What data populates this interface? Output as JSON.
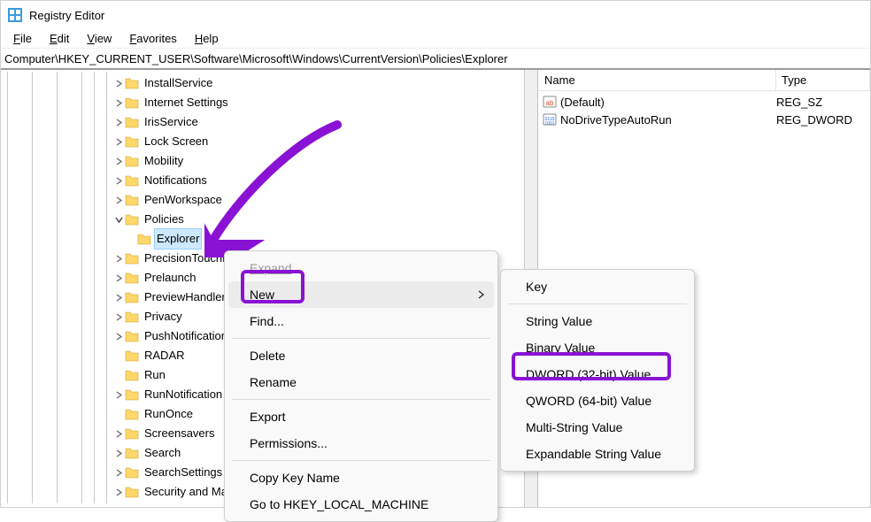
{
  "title": "Registry Editor",
  "menubar": {
    "file": "File",
    "edit": "Edit",
    "view": "View",
    "favorites": "Favorites",
    "help": "Help"
  },
  "address": "Computer\\HKEY_CURRENT_USER\\Software\\Microsoft\\Windows\\CurrentVersion\\Policies\\Explorer",
  "tree": [
    {
      "indent": 9,
      "exp": "r",
      "label": "InstallService"
    },
    {
      "indent": 9,
      "exp": "r",
      "label": "Internet Settings"
    },
    {
      "indent": 9,
      "exp": "r",
      "label": "IrisService"
    },
    {
      "indent": 9,
      "exp": "r",
      "label": "Lock Screen"
    },
    {
      "indent": 9,
      "exp": "r",
      "label": "Mobility"
    },
    {
      "indent": 9,
      "exp": "r",
      "label": "Notifications"
    },
    {
      "indent": 9,
      "exp": "r",
      "label": "PenWorkspace"
    },
    {
      "indent": 9,
      "exp": "d",
      "label": "Policies"
    },
    {
      "indent": 10,
      "exp": "",
      "label": "Explorer",
      "selected": true
    },
    {
      "indent": 9,
      "exp": "r",
      "label": "PrecisionTouchPad"
    },
    {
      "indent": 9,
      "exp": "r",
      "label": "Prelaunch"
    },
    {
      "indent": 9,
      "exp": "r",
      "label": "PreviewHandlers"
    },
    {
      "indent": 9,
      "exp": "r",
      "label": "Privacy"
    },
    {
      "indent": 9,
      "exp": "r",
      "label": "PushNotifications"
    },
    {
      "indent": 9,
      "exp": "",
      "label": "RADAR"
    },
    {
      "indent": 9,
      "exp": "",
      "label": "Run"
    },
    {
      "indent": 9,
      "exp": "r",
      "label": "RunNotification"
    },
    {
      "indent": 9,
      "exp": "",
      "label": "RunOnce"
    },
    {
      "indent": 9,
      "exp": "r",
      "label": "Screensavers"
    },
    {
      "indent": 9,
      "exp": "r",
      "label": "Search"
    },
    {
      "indent": 9,
      "exp": "r",
      "label": "SearchSettings"
    },
    {
      "indent": 9,
      "exp": "r",
      "label": "Security and Maintenance"
    }
  ],
  "indent_lines": [
    true,
    false,
    true,
    false,
    true,
    false,
    true,
    true,
    true,
    false
  ],
  "list": {
    "headers": {
      "name": "Name",
      "type": "Type"
    },
    "rows": [
      {
        "icon": "str",
        "name": "(Default)",
        "type": "REG_SZ"
      },
      {
        "icon": "num",
        "name": "NoDriveTypeAutoRun",
        "type": "REG_DWORD"
      }
    ]
  },
  "ctx1": {
    "expand": "Expand",
    "new": "New",
    "find": "Find...",
    "delete": "Delete",
    "rename": "Rename",
    "export": "Export",
    "permissions": "Permissions...",
    "copy": "Copy Key Name",
    "goto": "Go to HKEY_LOCAL_MACHINE"
  },
  "ctx2": {
    "key": "Key",
    "string": "String Value",
    "binary": "Binary Value",
    "dword": "DWORD (32-bit) Value",
    "qword": "QWORD (64-bit) Value",
    "multi": "Multi-String Value",
    "expand": "Expandable String Value"
  }
}
